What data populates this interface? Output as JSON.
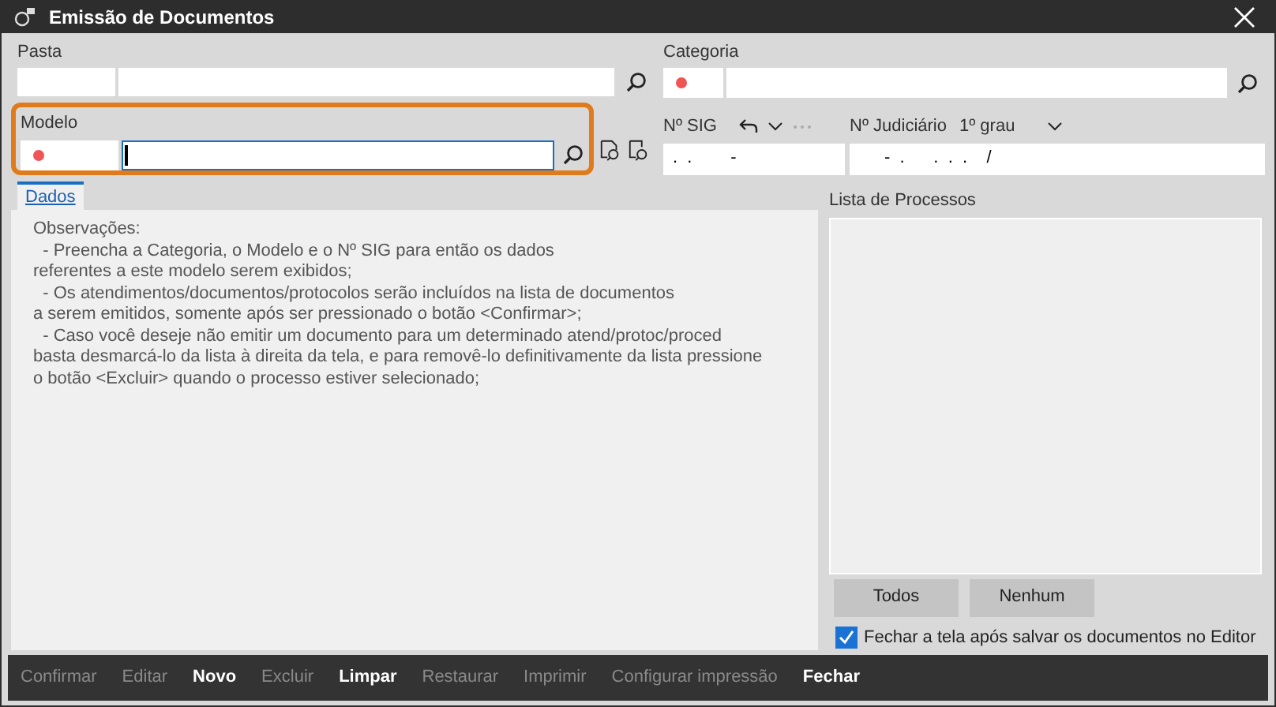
{
  "window": {
    "title": "Emissão de Documentos"
  },
  "pasta": {
    "label": "Pasta"
  },
  "categoria": {
    "label": "Categoria",
    "required": true
  },
  "modelo": {
    "label": "Modelo",
    "required": true,
    "highlighted": true
  },
  "sig": {
    "label": "Nº SIG",
    "value": ".  .        -"
  },
  "judiciario": {
    "label": "Nº Judiciário",
    "instance": "1º grau",
    "value": "-  .      .  .  .    /"
  },
  "tabs": [
    {
      "label": "Dados",
      "selected": true
    }
  ],
  "observacoes": [
    "Observações:",
    "  - Preencha a Categoria, o Modelo e o Nº SIG para então os dados",
    "referentes a este modelo serem exibidos;",
    "  - Os atendimentos/documentos/protocolos serão incluídos na lista de documentos",
    "a serem emitidos, somente após ser pressionado o botão <Confirmar>;",
    "  - Caso você deseje não emitir um documento para um determinado atend/protoc/proced",
    "basta desmarcá-lo da lista à direita da tela, e para removê-lo definitivamente da lista pressione",
    "o botão <Excluir> quando o processo estiver selecionado;"
  ],
  "lista": {
    "label": "Lista de Processos",
    "buttons": [
      "Todos",
      "Nenhum"
    ]
  },
  "fechar_option": {
    "label": "Fechar a tela após salvar os documentos no Editor",
    "checked": true
  },
  "toolbar": [
    {
      "label": "Confirmar",
      "disabled": true
    },
    {
      "label": "Editar",
      "disabled": true
    },
    {
      "label": "Novo",
      "disabled": false
    },
    {
      "label": "Excluir",
      "disabled": true
    },
    {
      "label": "Limpar",
      "disabled": false
    },
    {
      "label": "Restaurar",
      "disabled": true
    },
    {
      "label": "Imprimir",
      "disabled": true
    },
    {
      "label": "Configurar impressão",
      "disabled": true
    },
    {
      "label": "Fechar",
      "disabled": false
    }
  ]
}
